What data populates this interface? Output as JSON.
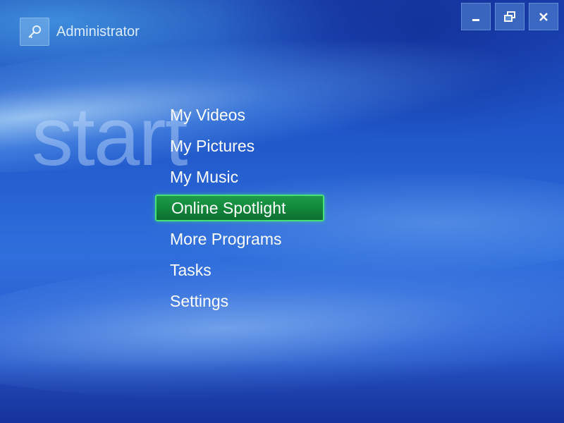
{
  "user": {
    "name": "Administrator",
    "icon": "key-icon"
  },
  "window_controls": {
    "minimize_icon": "minimize-icon",
    "restore_icon": "restore-icon",
    "close_icon": "close-icon"
  },
  "watermark": "start",
  "menu": {
    "items": [
      {
        "label": "My Videos"
      },
      {
        "label": "My Pictures"
      },
      {
        "label": "My Music"
      },
      {
        "label": "Online Spotlight",
        "selected": true
      },
      {
        "label": "More Programs"
      },
      {
        "label": "Tasks"
      },
      {
        "label": "Settings"
      }
    ]
  },
  "colors": {
    "background_accent": "#2a5ccf",
    "selection": "#138a3c",
    "selection_border": "#46e07a"
  }
}
